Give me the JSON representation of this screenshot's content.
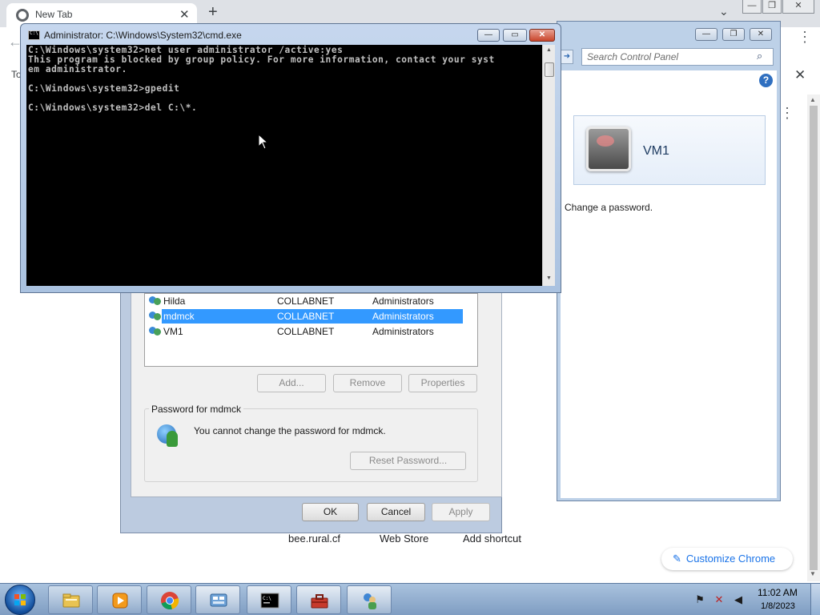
{
  "chrome": {
    "tab_title": "New Tab",
    "tab_close": "✕",
    "new_tab": "+",
    "chevron": "⌄",
    "caption_min": "—",
    "caption_max": "❐",
    "caption_close": "✕",
    "back": "←",
    "bookmark_partial": "To",
    "close_x": "✕",
    "shortcuts": [
      "bee.rural.cf",
      "Web Store",
      "Add shortcut"
    ],
    "customize_label": "Customize Chrome",
    "accent": "#1a73e8"
  },
  "control_panel": {
    "search_placeholder": "Search Control Panel",
    "user_name": "VM1",
    "change_password_link": "Change a password.",
    "help": "?",
    "caption_min": "—",
    "caption_max": "❐",
    "caption_close": "✕"
  },
  "user_accounts": {
    "rows": [
      {
        "name": "Hilda",
        "domain": "COLLABNET",
        "group": "Administrators"
      },
      {
        "name": "mdmck",
        "domain": "COLLABNET",
        "group": "Administrators",
        "selected": true
      },
      {
        "name": "VM1",
        "domain": "COLLABNET",
        "group": "Administrators"
      }
    ],
    "add_button": "Add...",
    "remove_button": "Remove",
    "properties_button": "Properties",
    "password_group_title": "Password for mdmck",
    "password_message": "You cannot change the password for mdmck.",
    "reset_password_button": "Reset Password...",
    "ok_button": "OK",
    "cancel_button": "Cancel",
    "apply_button": "Apply",
    "selection_color": "#3399ff"
  },
  "cmd": {
    "title": "Administrator: C:\\Windows\\System32\\cmd.exe",
    "caption_min": "—",
    "caption_max": "▭",
    "caption_close": "✕",
    "lines": [
      "C:\\Windows\\system32>net user administrator /active:yes",
      "This program is blocked by group policy. For more information, contact your syst",
      "em administrator.",
      "",
      "C:\\Windows\\system32>gpedit",
      "",
      "C:\\Windows\\system32>del C:\\*."
    ]
  },
  "taskbar": {
    "clock_time": "11:02 AM",
    "clock_date": "1/8/2023",
    "apps": [
      "explorer-icon",
      "media-player-icon",
      "chrome-icon",
      "control-panel-icon",
      "cmd-icon",
      "toolbox-icon",
      "user-accounts-icon"
    ]
  }
}
